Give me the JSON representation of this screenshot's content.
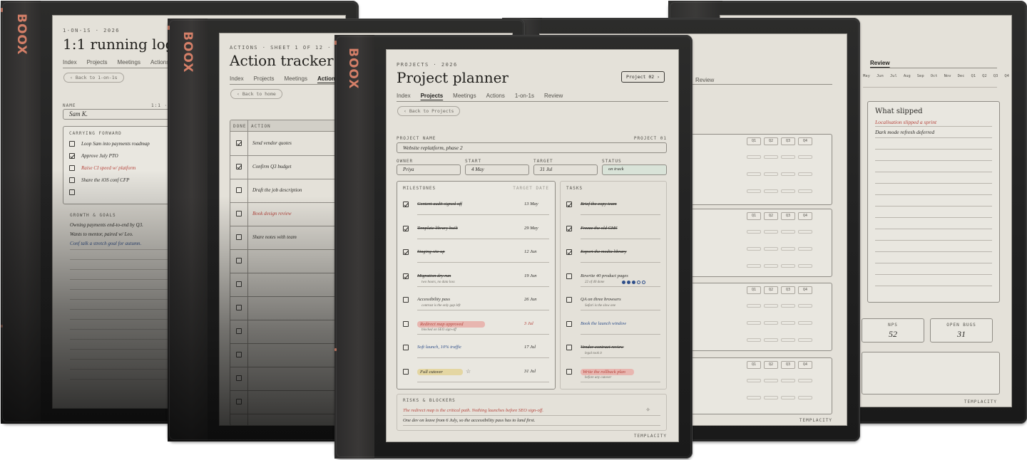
{
  "brand": "BOOX",
  "footer_logo": "TEMPLACITY",
  "d1": {
    "kicker": "1-ON-1S · 2026",
    "title": "1:1 running log",
    "nav": [
      "Index",
      "Projects",
      "Meetings",
      "Actions"
    ],
    "back": "‹ Back to 1-on-1s",
    "name_label": "NAME",
    "name_right": "1:1 ·",
    "name_value": "Sam K.",
    "carry_title": "CARRYING FORWARD",
    "carry": [
      {
        "text": "Loop Sam into payments roadmap",
        "checked": false
      },
      {
        "text": "Approve July PTO",
        "checked": true
      },
      {
        "text": "Raise CI speed w/ platform",
        "checked": false
      },
      {
        "text": "Share the iOS conf CFP",
        "checked": false
      },
      {
        "text": "",
        "checked": false
      }
    ],
    "growth_title": "GROWTH & GOALS",
    "growth": [
      "Owning payments end-to-end by Q3.",
      "Wants to mentor, paired w/ Leo.",
      "Conf talk a stretch goal for autumn."
    ]
  },
  "d2": {
    "kicker": "ACTIONS · SHEET 1 OF 12 · 20",
    "title": "Action tracker",
    "nav": [
      "Index",
      "Projects",
      "Meetings",
      "Actions"
    ],
    "back": "‹ Back to home",
    "col_done": "DONE",
    "col_action": "ACTION",
    "rows": [
      {
        "text": "Send vendor quotes",
        "checked": true,
        "tone": "ink"
      },
      {
        "text": "Confirm Q3 budget",
        "checked": true,
        "tone": "ink"
      },
      {
        "text": "Draft the job description",
        "checked": false,
        "tone": "ink"
      },
      {
        "text": "Book design review",
        "checked": false,
        "tone": "red"
      },
      {
        "text": "Share notes with team",
        "checked": false,
        "tone": "ink"
      },
      {
        "text": "",
        "checked": false,
        "tone": "ink"
      },
      {
        "text": "",
        "checked": false,
        "tone": "ink"
      },
      {
        "text": "",
        "checked": false,
        "tone": "ink"
      },
      {
        "text": "",
        "checked": false,
        "tone": "ink"
      },
      {
        "text": "",
        "checked": false,
        "tone": "ink"
      },
      {
        "text": "",
        "checked": false,
        "tone": "ink"
      },
      {
        "text": "",
        "checked": false,
        "tone": "ink"
      }
    ]
  },
  "d3": {
    "kicker": "PROJECTS · 2026",
    "title": "Project planner",
    "pill": "Project 02 ›",
    "nav": [
      "Index",
      "Projects",
      "Meetings",
      "Actions",
      "1-on-1s",
      "Review"
    ],
    "back": "‹ Back to Projects",
    "project_name_label": "PROJECT NAME",
    "project_id": "PROJECT 01",
    "project_name": "Website replatform, phase 2",
    "owner_label": "OWNER",
    "owner": "Priya",
    "start_label": "START",
    "start": "4 May",
    "target_label": "TARGET",
    "target": "31 Jul",
    "status_label": "STATUS",
    "status": "on track",
    "milestones_title": "MILESTONES",
    "milestones_right": "TARGET DATE",
    "milestones": [
      {
        "text": "Content audit signed off",
        "date": "13 May",
        "done": true,
        "style": "strike",
        "sub": ""
      },
      {
        "text": "Template library built",
        "date": "29 May",
        "done": true,
        "style": "strike",
        "sub": ""
      },
      {
        "text": "Staging site up",
        "date": "12 Jun",
        "done": true,
        "style": "strike",
        "sub": ""
      },
      {
        "text": "Migration dry run",
        "date": "19 Jun",
        "done": true,
        "style": "strike",
        "sub": "two hours, no data loss"
      },
      {
        "text": "Accessibility pass",
        "date": "26 Jun",
        "done": false,
        "style": "plain",
        "sub": "contrast is the only gap left"
      },
      {
        "text": "Redirect map approved",
        "date": "3 Jul",
        "done": false,
        "style": "red",
        "sub": "blocked on SEO sign-off"
      },
      {
        "text": "Soft launch, 10% traffic",
        "date": "17 Jul",
        "done": false,
        "style": "blue",
        "sub": ""
      },
      {
        "text": "Full cutover",
        "date": "31 Jul",
        "done": false,
        "style": "yellow",
        "sub": "",
        "star": "☆"
      }
    ],
    "tasks_title": "TASKS",
    "tasks": [
      {
        "text": "Brief the copy team",
        "done": true,
        "style": "strike",
        "sub": ""
      },
      {
        "text": "Freeze the old CMS",
        "done": true,
        "style": "strike",
        "sub": ""
      },
      {
        "text": "Export the media library",
        "done": true,
        "style": "strike",
        "sub": ""
      },
      {
        "text": "Rewrite 40 product pages",
        "done": false,
        "style": "plain",
        "sub": "22 of 40 done",
        "dots": [
          1,
          1,
          1,
          0,
          0
        ]
      },
      {
        "text": "QA on three browsers",
        "done": false,
        "style": "plain",
        "sub": "Safari is the slow one"
      },
      {
        "text": "Book the launch window",
        "done": false,
        "style": "blue",
        "sub": ""
      },
      {
        "text": "Vendor contract review",
        "done": false,
        "style": "strike",
        "sub": "legal took it"
      },
      {
        "text": "Write the rollback plan",
        "done": false,
        "style": "red",
        "sub": "before any cutover"
      }
    ],
    "risks_title": "RISKS & BLOCKERS",
    "risks": [
      "The redirect map is the critical path. Nothing launches before SEO sign-off.",
      "One dev on leave from 6 July, so the accessibility pass has to land first."
    ],
    "risk_star": "✧"
  },
  "d4": {
    "nav": [
      "s",
      "Review"
    ],
    "quarters": [
      "Q1",
      "Q2",
      "Q3",
      "Q4"
    ]
  },
  "d5": {
    "nav_active": "Review",
    "months": [
      "May",
      "Jun",
      "Jul",
      "Aug",
      "Sep",
      "Oct",
      "Nov",
      "Dec",
      "Q1",
      "Q2",
      "Q3",
      "Q4"
    ],
    "slipped_title": "What slipped",
    "slipped": [
      "Localisation slipped a sprint",
      "Dark mode refresh deferred"
    ],
    "nps_label": "NPS",
    "nps": "52",
    "bugs_label": "OPEN BUGS",
    "bugs": "31"
  },
  "colors": {
    "screen": "#e4e1d9",
    "accent": "#d47f68",
    "red_ink": "#b5423a",
    "blue_ink": "#2f4f8a"
  }
}
